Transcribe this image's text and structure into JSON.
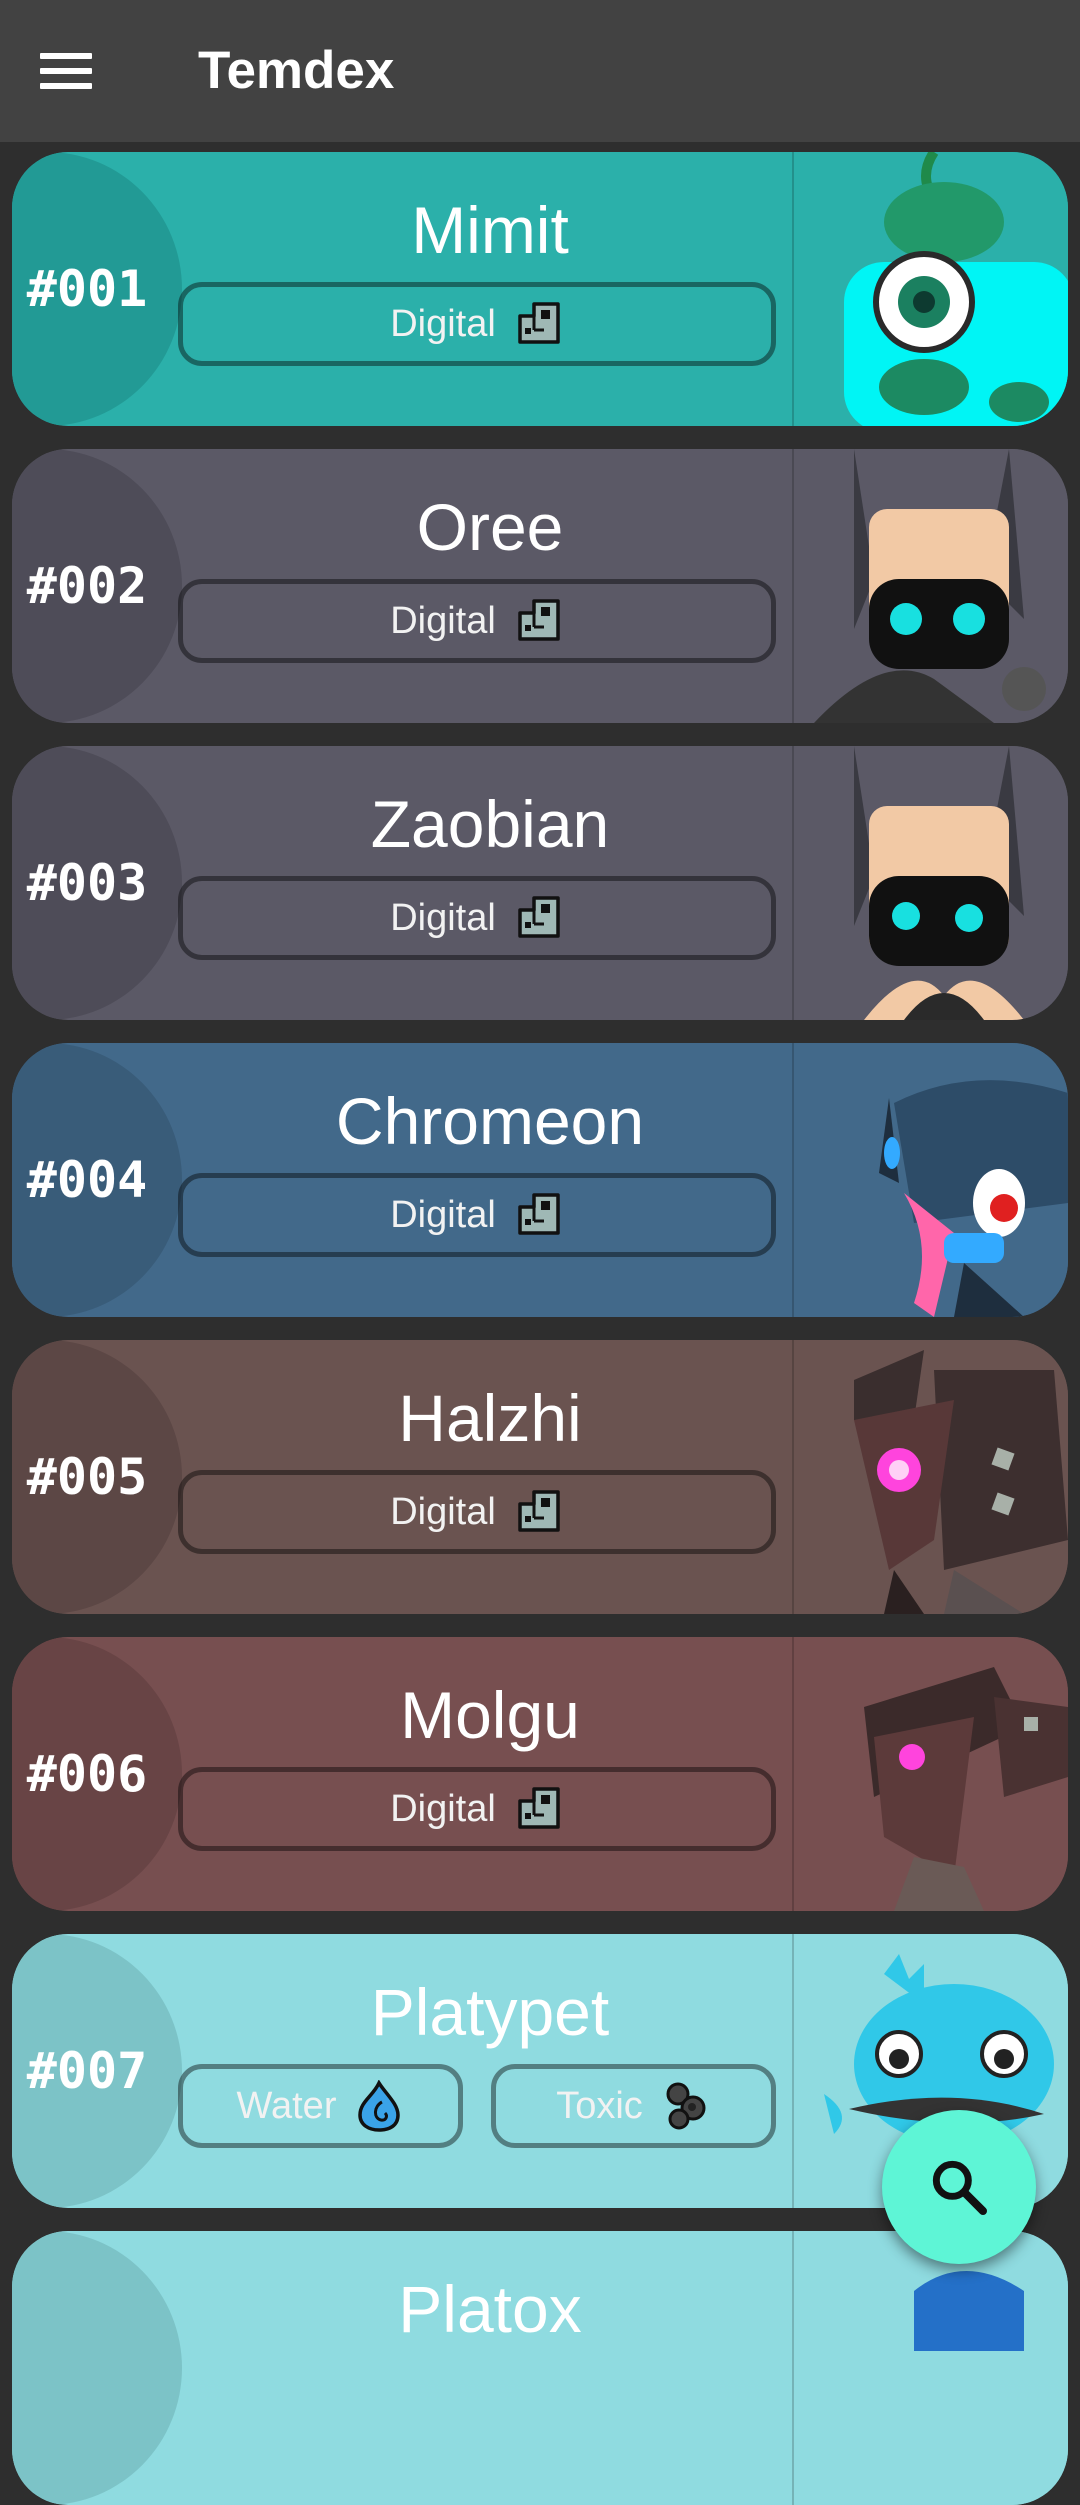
{
  "app": {
    "title": "Temdex"
  },
  "temtems": [
    {
      "number": "#001",
      "name": "Mimit",
      "types": [
        {
          "label": "Digital",
          "icon": "digital-type-icon"
        }
      ],
      "color": "#2bb0aa",
      "circle": "#229a95"
    },
    {
      "number": "#002",
      "name": "Oree",
      "types": [
        {
          "label": "Digital",
          "icon": "digital-type-icon"
        }
      ],
      "color": "#5b5966",
      "circle": "#4e4c58"
    },
    {
      "number": "#003",
      "name": "Zaobian",
      "types": [
        {
          "label": "Digital",
          "icon": "digital-type-icon"
        }
      ],
      "color": "#5b5966",
      "circle": "#4e4c58"
    },
    {
      "number": "#004",
      "name": "Chromeon",
      "types": [
        {
          "label": "Digital",
          "icon": "digital-type-icon"
        }
      ],
      "color": "#42698a",
      "circle": "#395c79"
    },
    {
      "number": "#005",
      "name": "Halzhi",
      "types": [
        {
          "label": "Digital",
          "icon": "digital-type-icon"
        }
      ],
      "color": "#6a5350",
      "circle": "#5c4745"
    },
    {
      "number": "#006",
      "name": "Molgu",
      "types": [
        {
          "label": "Digital",
          "icon": "digital-type-icon"
        }
      ],
      "color": "#774f50",
      "circle": "#684445"
    },
    {
      "number": "#007",
      "name": "Platypet",
      "types": [
        {
          "label": "Water",
          "icon": "water-type-icon"
        },
        {
          "label": "Toxic",
          "icon": "toxic-type-icon"
        }
      ],
      "color": "#8fdbe0",
      "circle": "#7cc3c7"
    },
    {
      "number": "",
      "name": "Platox",
      "types": [],
      "color": "#8fdbe0",
      "circle": "#7cc3c7"
    }
  ],
  "fab": {
    "icon": "search-icon"
  }
}
